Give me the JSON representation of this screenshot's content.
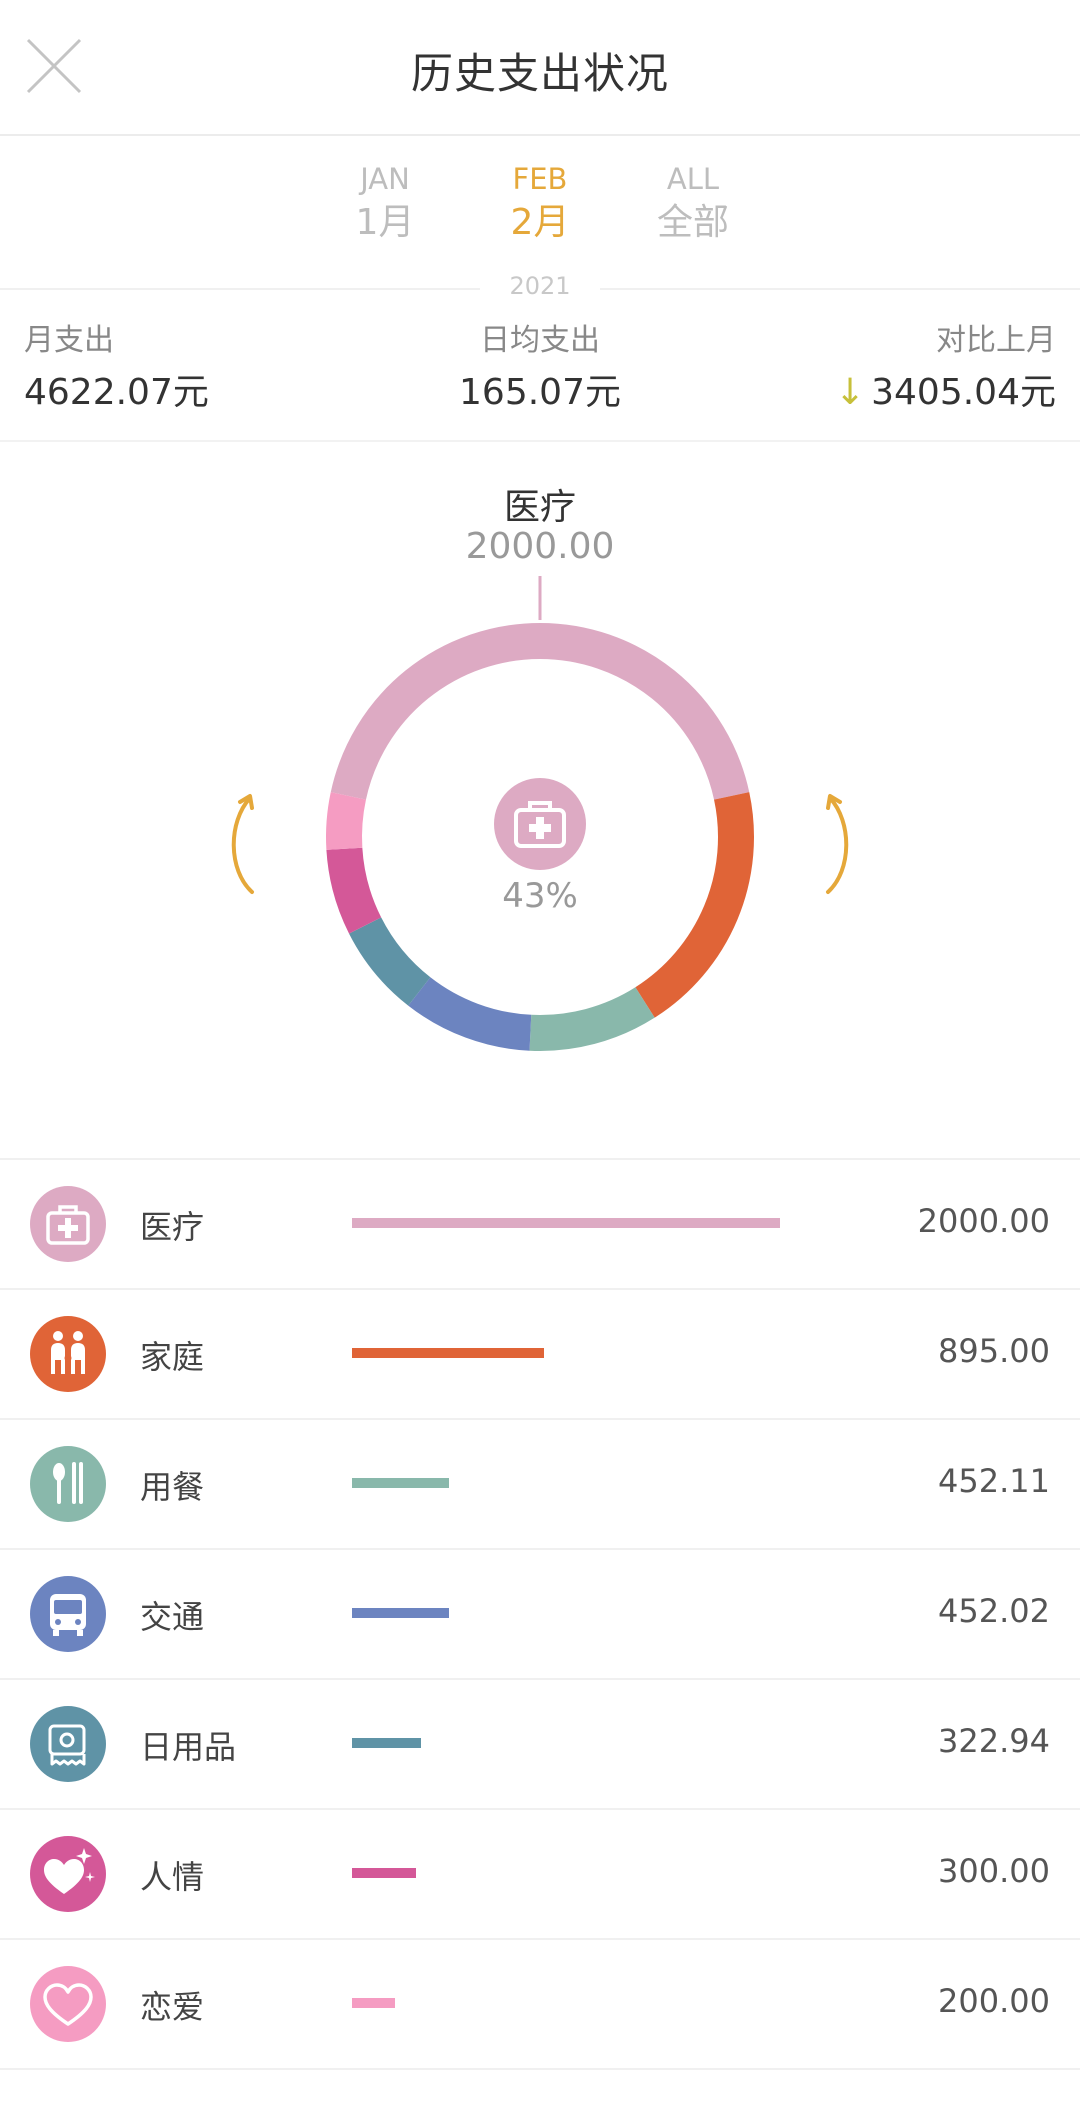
{
  "header": {
    "title": "历史支出状况",
    "close_icon": "close-icon"
  },
  "tabs": [
    {
      "en": "JAN",
      "cn": "1月",
      "active": false
    },
    {
      "en": "FEB",
      "cn": "2月",
      "active": true
    },
    {
      "en": "ALL",
      "cn": "全部",
      "active": false
    }
  ],
  "year": "2021",
  "summary": {
    "month_label": "月支出",
    "month_value": "4622.07元",
    "daily_label": "日均支出",
    "daily_value": "165.07元",
    "compare_label": "对比上月",
    "compare_arrow": "↓",
    "compare_value": "3405.04元"
  },
  "focus": {
    "name": "医疗",
    "value": "2000.00",
    "percent": "43%",
    "icon": "medical-kit-icon"
  },
  "colors": {
    "accent": "#e5a83a",
    "medical": "#ddaac3",
    "family": "#e06437",
    "dining": "#89b8ab",
    "transport": "#6c84c0",
    "daily": "#5f93a6",
    "social": "#d45898",
    "love": "#f59cc2"
  },
  "categories": [
    {
      "name": "医疗",
      "amount": "2000.00",
      "value": 2000.0,
      "color": "#ddaac3",
      "icon": "medical-kit-icon"
    },
    {
      "name": "家庭",
      "amount": "895.00",
      "value": 895.0,
      "color": "#e06437",
      "icon": "family-icon"
    },
    {
      "name": "用餐",
      "amount": "452.11",
      "value": 452.11,
      "color": "#89b8ab",
      "icon": "spoon-chopsticks-icon"
    },
    {
      "name": "交通",
      "amount": "452.02",
      "value": 452.02,
      "color": "#6c84c0",
      "icon": "bus-icon"
    },
    {
      "name": "日用品",
      "amount": "322.94",
      "value": 322.94,
      "color": "#5f93a6",
      "icon": "toilet-paper-icon"
    },
    {
      "name": "人情",
      "amount": "300.00",
      "value": 300.0,
      "color": "#d45898",
      "icon": "sparkle-heart-icon"
    },
    {
      "name": "恋爱",
      "amount": "200.00",
      "value": 200.0,
      "color": "#f59cc2",
      "icon": "heart-icon"
    }
  ]
}
